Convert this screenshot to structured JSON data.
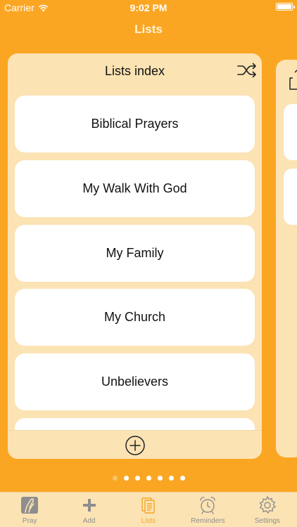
{
  "status_bar": {
    "carrier": "Carrier",
    "time": "9:02 PM"
  },
  "nav": {
    "title": "Lists"
  },
  "card": {
    "title": "Lists index",
    "items": [
      {
        "label": "Biblical Prayers"
      },
      {
        "label": "My Walk With God"
      },
      {
        "label": "My Family"
      },
      {
        "label": "My Church"
      },
      {
        "label": "Unbelievers"
      },
      {
        "label": ""
      }
    ]
  },
  "pager": {
    "count": 7,
    "active_index": 0
  },
  "tabs": [
    {
      "label": "Pray",
      "icon": "praying-hands-icon",
      "selected": false
    },
    {
      "label": "Add",
      "icon": "plus-icon",
      "selected": false
    },
    {
      "label": "Lists",
      "icon": "lists-icon",
      "selected": true
    },
    {
      "label": "Reminders",
      "icon": "alarm-clock-icon",
      "selected": false
    },
    {
      "label": "Settings",
      "icon": "gear-icon",
      "selected": false
    }
  ],
  "colors": {
    "background": "#FBA623",
    "card": "#FCE3B4",
    "tab_selected": "#F5A623",
    "tab_unselected": "#8E8E8E"
  }
}
